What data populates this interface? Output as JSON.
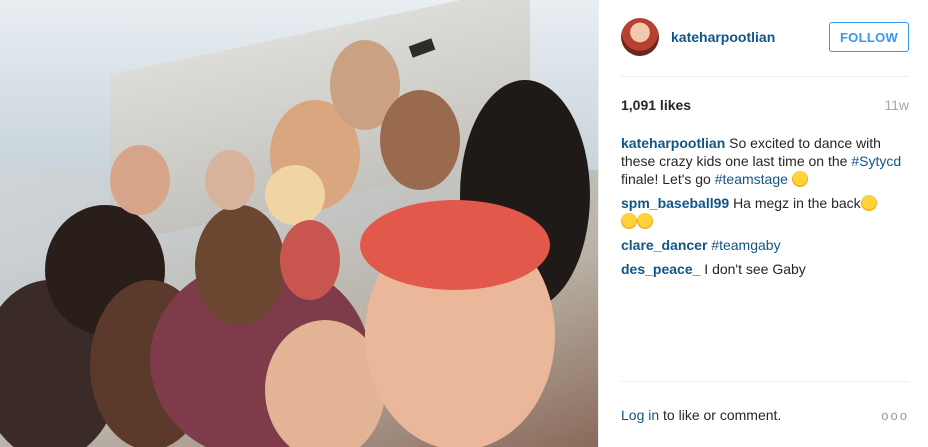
{
  "header": {
    "username": "kateharpootlian",
    "follow_label": "FOLLOW"
  },
  "post": {
    "likes": "1,091 likes",
    "age": "11w"
  },
  "comments": [
    {
      "user": "kateharpootlian",
      "parts": [
        "So excited to dance with these crazy kids one last time on the ",
        "#Sytycd",
        " finale! Let's go ",
        "#teamstage"
      ],
      "emoji": "heart-eyes-emoji"
    },
    {
      "user": "spm_baseball99",
      "text": "Ha megz in the back",
      "emoji": "tears-of-joy-emoji"
    },
    {
      "user": "clare_dancer",
      "tag": "#teamgaby"
    },
    {
      "user": "des_peace_",
      "text": "I don't see Gaby"
    }
  ],
  "footer": {
    "login_label": "Log in",
    "suffix": "to like or comment.",
    "more_label": "ooo"
  },
  "colors": {
    "link": "#125688",
    "follow_blue": "#3897f0",
    "muted": "#a5a7aa"
  }
}
